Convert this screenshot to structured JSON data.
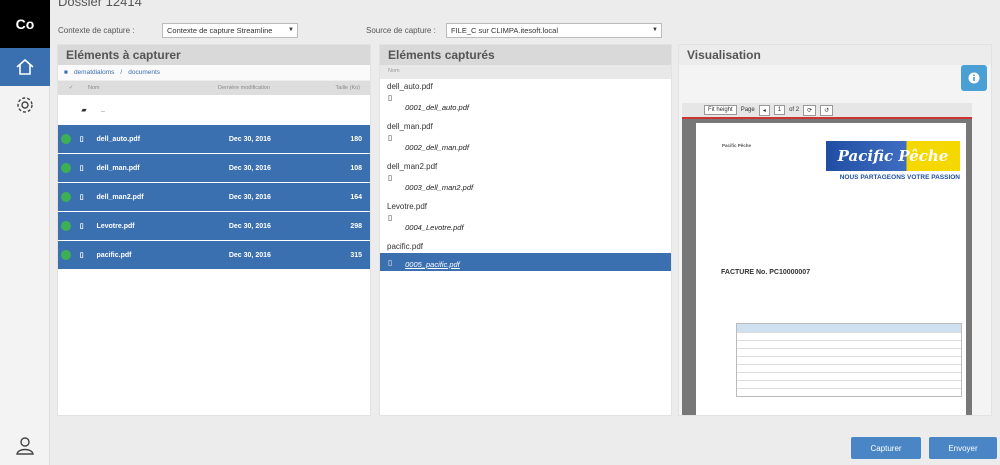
{
  "app": {
    "logo": "Co",
    "title": "Dossier 12414"
  },
  "header": {
    "context_label": "Contexte de capture :",
    "context_value": "Contexte de capture Streamline",
    "source_label": "Source de capture :",
    "source_value": "FILE_C sur CLIMPA.itesoft.local"
  },
  "panel1": {
    "title": "Eléments à capturer",
    "breadcrumb": [
      "dematdialoms",
      "documents"
    ],
    "columns": [
      "Nom",
      "Dernière modification",
      "Taille (Ko)"
    ],
    "parent_row": "..",
    "rows": [
      {
        "name": "dell_auto.pdf",
        "date": "Dec 30, 2016",
        "size": "180"
      },
      {
        "name": "dell_man.pdf",
        "date": "Dec 30, 2016",
        "size": "108"
      },
      {
        "name": "dell_man2.pdf",
        "date": "Dec 30, 2016",
        "size": "164"
      },
      {
        "name": "Levotre.pdf",
        "date": "Dec 30, 2016",
        "size": "298"
      },
      {
        "name": "pacific.pdf",
        "date": "Dec 30, 2016",
        "size": "315"
      }
    ]
  },
  "panel2": {
    "title": "Eléments capturés",
    "column": "Nom",
    "groups": [
      {
        "name": "dell_auto.pdf",
        "item": "0001_dell_auto.pdf"
      },
      {
        "name": "dell_man.pdf",
        "item": "0002_dell_man.pdf"
      },
      {
        "name": "dell_man2.pdf",
        "item": "0003_dell_man2.pdf"
      },
      {
        "name": "Levotre.pdf",
        "item": "0004_Levotre.pdf"
      },
      {
        "name": "pacific.pdf",
        "item": "0005_pacific.pdf"
      }
    ]
  },
  "panel3": {
    "title": "Visualisation",
    "zoom": "Fit height",
    "page_label": "Page",
    "page_num": "1",
    "page_total": "of 2",
    "doc": {
      "sender": "Pacific Pêche",
      "brand": "Pacific Pêche",
      "slogan": "NOUS PARTAGEONS VOTRE PASSION",
      "invoice": "FACTURE No. PC10000007"
    }
  },
  "footer": {
    "capture": "Capturer",
    "send": "Envoyer"
  },
  "colors": {
    "accent": "#3a6fb0",
    "status_green": "#3db056",
    "button": "#4a86c6"
  }
}
